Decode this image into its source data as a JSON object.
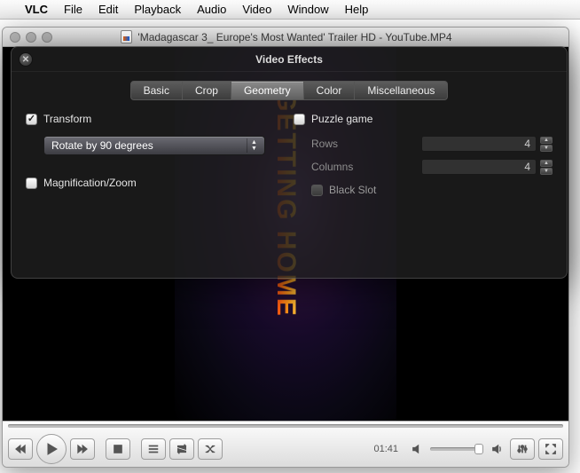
{
  "menubar": {
    "app": "VLC",
    "items": [
      "File",
      "Edit",
      "Playback",
      "Audio",
      "Video",
      "Window",
      "Help"
    ]
  },
  "window": {
    "title": "'Madagascar 3_ Europe's Most Wanted' Trailer HD - YouTube.MP4"
  },
  "video": {
    "overlay_text": "GETTING HOME"
  },
  "playback": {
    "time": "01:41"
  },
  "panel": {
    "title": "Video Effects",
    "tabs": [
      "Basic",
      "Crop",
      "Geometry",
      "Color",
      "Miscellaneous"
    ],
    "active_tab": "Geometry",
    "transform": {
      "label": "Transform",
      "checked": true,
      "option": "Rotate by 90 degrees"
    },
    "magnification": {
      "label": "Magnification/Zoom",
      "checked": false
    },
    "puzzle": {
      "label": "Puzzle game",
      "checked": false,
      "rows_label": "Rows",
      "rows_value": "4",
      "cols_label": "Columns",
      "cols_value": "4",
      "blackslot_label": "Black Slot",
      "blackslot_checked": false
    }
  }
}
